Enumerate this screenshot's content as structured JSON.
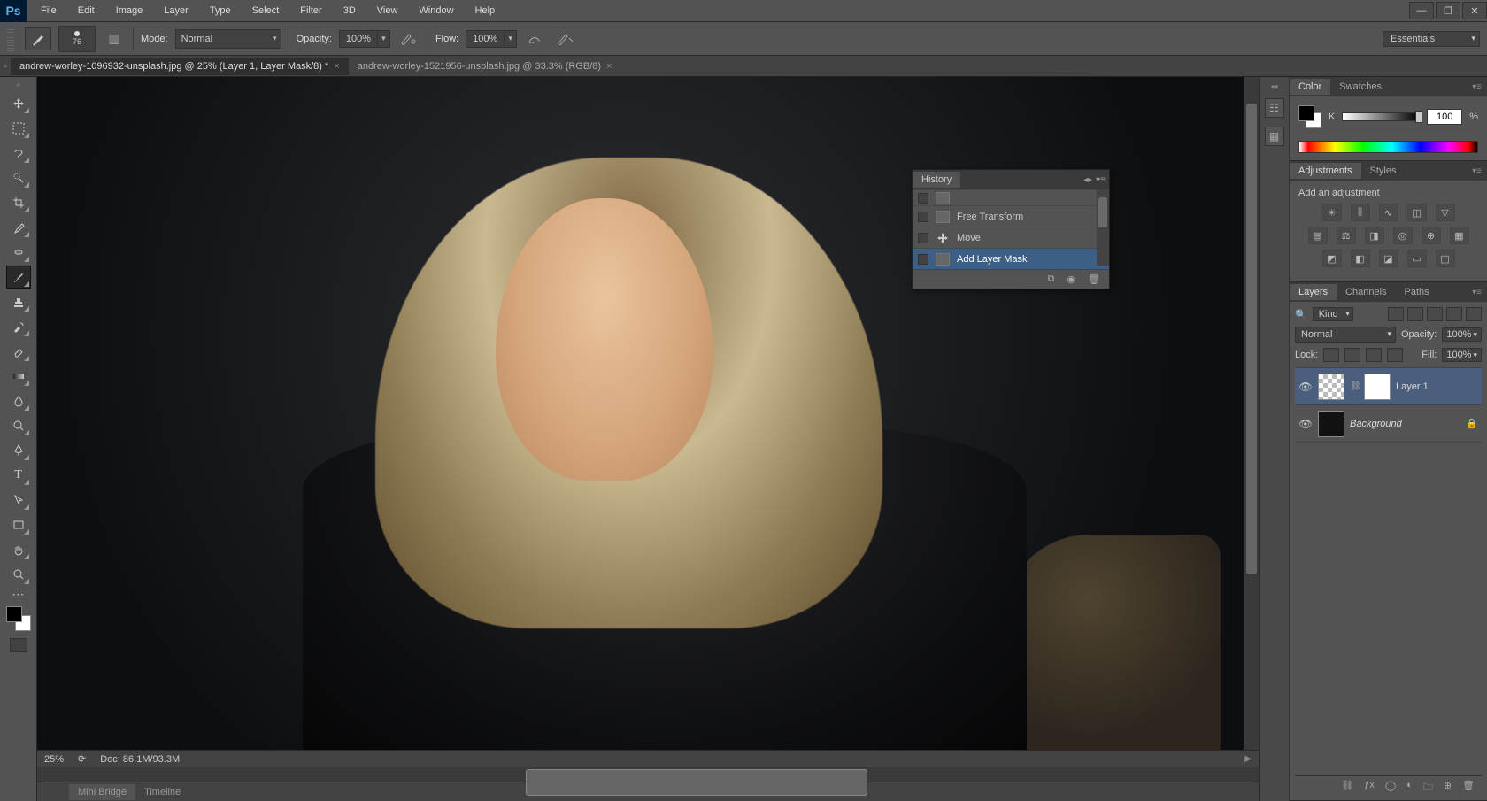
{
  "app": {
    "logo": "Ps"
  },
  "menu": [
    "File",
    "Edit",
    "Image",
    "Layer",
    "Type",
    "Select",
    "Filter",
    "3D",
    "View",
    "Window",
    "Help"
  ],
  "options": {
    "brush_size": "76",
    "mode_label": "Mode:",
    "mode_value": "Normal",
    "opacity_label": "Opacity:",
    "opacity_value": "100%",
    "flow_label": "Flow:",
    "flow_value": "100%"
  },
  "workspace": {
    "name": "Essentials"
  },
  "tabs": [
    {
      "title": "andrew-worley-1096932-unsplash.jpg @ 25% (Layer 1, Layer Mask/8) *",
      "active": true
    },
    {
      "title": "andrew-worley-1521956-unsplash.jpg @ 33.3% (RGB/8)",
      "active": false
    }
  ],
  "status": {
    "zoom": "25%",
    "doc": "Doc: 86.1M/93.3M"
  },
  "bottom_tabs": [
    "Mini Bridge",
    "Timeline"
  ],
  "history": {
    "tab": "History",
    "rows": [
      {
        "label": "Free Transform",
        "selected": false
      },
      {
        "label": "Move",
        "selected": false
      },
      {
        "label": "Add Layer Mask",
        "selected": true
      }
    ]
  },
  "color_panel": {
    "tabs": [
      "Color",
      "Swatches"
    ],
    "k_label": "K",
    "k_value": "100",
    "k_pct": "%"
  },
  "adjust_panel": {
    "tabs": [
      "Adjustments",
      "Styles"
    ],
    "title": "Add an adjustment"
  },
  "layers_panel": {
    "tabs": [
      "Layers",
      "Channels",
      "Paths"
    ],
    "filter_label": "Kind",
    "blend_mode": "Normal",
    "opacity_label": "Opacity:",
    "opacity_value": "100%",
    "lock_label": "Lock:",
    "fill_label": "Fill:",
    "fill_value": "100%",
    "layers": [
      {
        "name": "Layer 1",
        "selected": true,
        "has_mask": true,
        "locked": false,
        "italic": false
      },
      {
        "name": "Background",
        "selected": false,
        "has_mask": false,
        "locked": true,
        "italic": true
      }
    ]
  }
}
